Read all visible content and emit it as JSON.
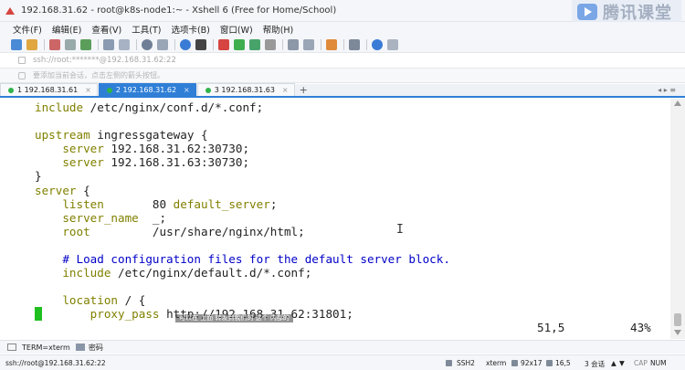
{
  "window": {
    "title": "192.168.31.62 - root@k8s-node1:~ - Xshell 6 (Free for Home/School)",
    "brand_text": "腾讯课堂"
  },
  "menu": [
    "文件(F)",
    "编辑(E)",
    "查看(V)",
    "工具(T)",
    "选项卡(B)",
    "窗口(W)",
    "帮助(H)"
  ],
  "address_bar": "ssh://root:*******@192.168.31.62:22",
  "hint_bar": "要添加当前会话，点击左侧的箭头按钮。",
  "tabs": [
    {
      "label": "1 192.168.31.61",
      "active": false
    },
    {
      "label": "2 192.168.31.62",
      "active": true
    },
    {
      "label": "3 192.168.31.63",
      "active": false
    }
  ],
  "tab_add": "+",
  "tab_nav": "◂ ▸ ≡",
  "terminal": {
    "lines": [
      {
        "k": "include",
        "r": " /etc/nginx/conf.d/*.conf;"
      },
      {
        "k": "",
        "r": ""
      },
      {
        "k": "upstream",
        "r": " ingressgateway {"
      },
      {
        "k": "    server",
        "r": " 192.168.31.62:30730;"
      },
      {
        "k": "    server",
        "r": " 192.168.31.63:30730;"
      },
      {
        "k": "",
        "r": "}"
      },
      {
        "k": "server",
        "r": " {"
      },
      {
        "k": "    listen",
        "r": "       80 ",
        "k2": "default_server",
        "r2": ";"
      },
      {
        "k": "    server_name",
        "r": "  _;"
      },
      {
        "k": "    root",
        "r": "         /usr/share/nginx/html;"
      },
      {
        "k": "",
        "r": ""
      },
      {
        "c": "    # Load configuration files for the default server block."
      },
      {
        "k": "    include",
        "r": " /etc/nginx/default.d/*.conf;"
      },
      {
        "k": "",
        "r": ""
      },
      {
        "k": "    location",
        "r": " / {"
      },
      {
        "k": "        proxy_pass",
        "r": " http://192.168.31.62:31801;"
      }
    ],
    "cursor_pos": "51,5",
    "scroll_percent": "43%",
    "subtitle_overlay": "可以在 上面 转发到我们的 这个 内部的"
  },
  "options_bar": {
    "term_label": "TERM=xterm",
    "encoding_label": "密码"
  },
  "statusbar": {
    "connection": "ssh://root@192.168.31.62:22",
    "protocol": "SSH2",
    "term": "xterm",
    "size": "92x17",
    "cursor": "16,5",
    "sessions": "3 会话",
    "cap": "CAP",
    "num": "NUM"
  },
  "colors": {
    "keyword": "#808000",
    "comment": "#0000c8",
    "cursor": "#1fbf1f",
    "tab_active": "#2f7fd7"
  }
}
